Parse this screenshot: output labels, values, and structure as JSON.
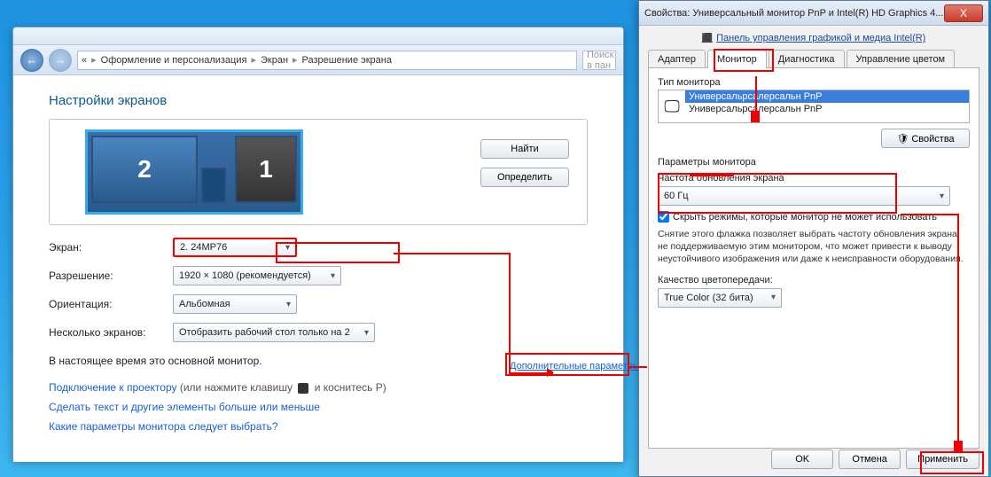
{
  "main": {
    "breadcrumb": {
      "root_icon": "«",
      "p1": "Оформление и персонализация",
      "p2": "Экран",
      "p3": "Разрешение экрана"
    },
    "search_placeholder": "Поиск в пан",
    "heading": "Настройки экранов",
    "monitors": {
      "m1": "1",
      "m2": "2"
    },
    "buttons": {
      "find": "Найти",
      "detect": "Определить"
    },
    "form": {
      "screen_label": "Экран:",
      "screen_value": "2. 24MP76",
      "res_label": "Разрешение:",
      "res_value": "1920 × 1080 (рекомендуется)",
      "orient_label": "Ориентация:",
      "orient_value": "Альбомная",
      "multi_label": "Несколько экранов:",
      "multi_value": "Отобразить рабочий стол только на 2"
    },
    "primary_note": "В настоящее время это основной монитор.",
    "adv_link": "Дополнительные параметры",
    "links": {
      "projector": "Подключение к проектору",
      "projector_hint": "(или нажмите клавишу",
      "projector_hint2": "и коснитесь P)",
      "text_size": "Сделать текст и другие элементы больше или меньше",
      "which": "Какие параметры монитора следует выбрать?"
    }
  },
  "prop": {
    "title": "Свойства: Универсальный монитор PnP и Intel(R) HD Graphics 4...",
    "intel_panel": "Панель управления графикой и медиа Intel(R)",
    "tabs": {
      "adapter": "Адаптер",
      "monitor": "Монитор",
      "diagnostics": "Диагностика",
      "color": "Управление цветом"
    },
    "type_label": "Тип монитора",
    "monitor_items": {
      "a": "Универсальрсалерсальн PnP",
      "b": "Универсальрсалерсальн PnP"
    },
    "props_btn": "Свойства",
    "params_label": "Параметры монитора",
    "refresh_label": "Частота обновления экрана",
    "refresh_value": "60 Гц",
    "hide_modes": "Скрыть режимы, которые монитор не может использовать",
    "hint": "Снятие этого флажка позволяет выбрать частоту обновления экрана, не поддерживаемую этим монитором, что может привести к выводу неустойчивого изображения или даже к неисправности оборудования.",
    "color_label": "Качество цветопередачи:",
    "color_value": "True Color (32 бита)",
    "ok": "OK",
    "cancel": "Отмена",
    "apply": "Применить"
  }
}
